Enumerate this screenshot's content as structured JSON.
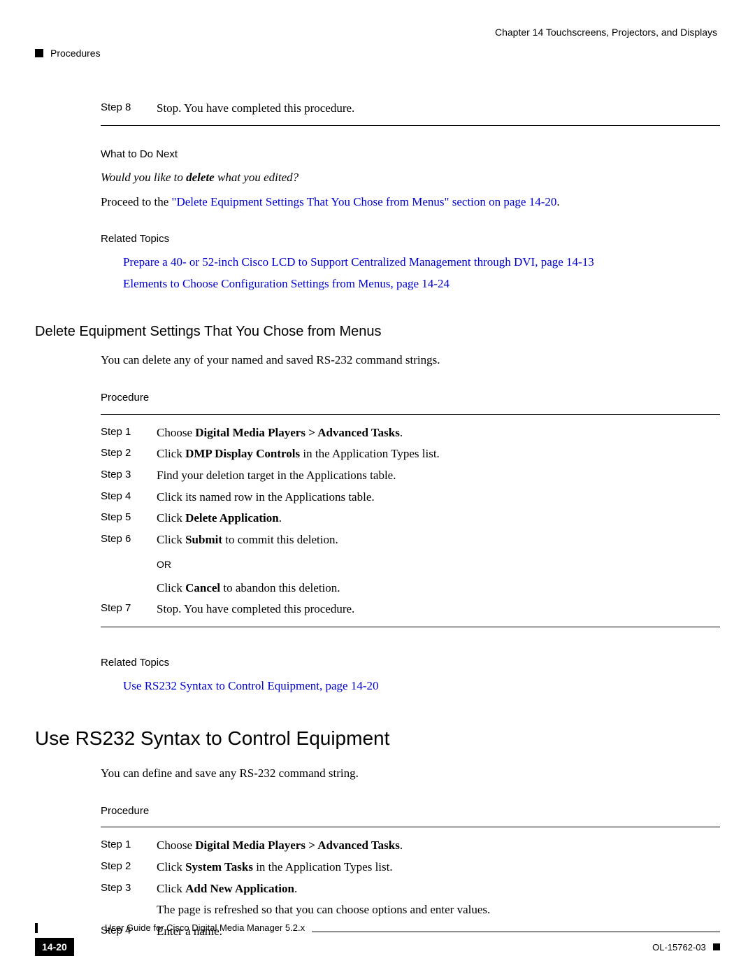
{
  "header": {
    "right_chapter": "Chapter 14      Touchscreens, Projectors, and Displays",
    "left_section": "Procedures"
  },
  "step8": {
    "label": "Step 8",
    "text": "Stop. You have completed this procedure."
  },
  "what_next_heading": "What to Do Next",
  "what_next_q_prefix": "Would you like to ",
  "what_next_q_bold": "delete",
  "what_next_q_suffix": " what you edited?",
  "proceed_prefix": "Proceed to the ",
  "proceed_link": "\"Delete Equipment Settings That You Chose from Menus\" section on page 14-20",
  "proceed_suffix": ".",
  "related_topics_label": "Related Topics",
  "rt1_link": "Prepare a 40- or 52-inch Cisco LCD to Support Centralized Management through DVI, page 14-13",
  "rt2_link": "Elements to Choose Configuration Settings from Menus, page 14-24",
  "section_delete_title": "Delete Equipment Settings That You Chose from Menus",
  "section_delete_intro": "You can delete any of your named and saved RS-232 command strings.",
  "procedure_label": "Procedure",
  "delete_steps": {
    "s1_label": "Step 1",
    "s1_prefix": "Choose ",
    "s1_bold": "Digital Media Players > Advanced Tasks",
    "s1_suffix": ".",
    "s2_label": "Step 2",
    "s2_prefix": "Click ",
    "s2_bold": "DMP Display Controls",
    "s2_suffix": " in the Application Types list.",
    "s3_label": "Step 3",
    "s3_text": "Find your deletion target in the Applications table.",
    "s4_label": "Step 4",
    "s4_text": "Click its named row in the Applications table.",
    "s5_label": "Step 5",
    "s5_prefix": "Click     ",
    "s5_bold": " Delete Application",
    "s5_suffix": ".",
    "s6_label": "Step 6",
    "s6_prefix": "Click ",
    "s6_bold": "Submit",
    "s6_suffix": " to commit this deletion.",
    "or_text": "OR",
    "s6b_prefix": "Click ",
    "s6b_bold": "Cancel",
    "s6b_suffix": " to abandon this deletion.",
    "s7_label": "Step 7",
    "s7_text": "Stop. You have completed this procedure."
  },
  "rt3_link": "Use RS232 Syntax to Control Equipment, page 14-20",
  "section_rs232_title": "Use RS232 Syntax to Control Equipment",
  "section_rs232_intro": "You can define and save any RS-232 command string.",
  "rs232_steps": {
    "s1_label": "Step 1",
    "s1_prefix": "Choose ",
    "s1_bold": "Digital Media Players > Advanced Tasks",
    "s1_suffix": ".",
    "s2_label": "Step 2",
    "s2_prefix": "Click ",
    "s2_bold": "System Tasks",
    "s2_suffix": " in the Application Types list.",
    "s3_label": "Step 3",
    "s3_prefix": "Click     ",
    "s3_bold": " Add New Application",
    "s3_suffix": ".",
    "s3b_text": "The page is refreshed so that you can choose options and enter values.",
    "s4_label": "Step 4",
    "s4_text": "Enter a name."
  },
  "footer": {
    "title": "User Guide for Cisco Digital Media Manager 5.2.x",
    "page_num": "14-20",
    "doc_id": "OL-15762-03"
  }
}
